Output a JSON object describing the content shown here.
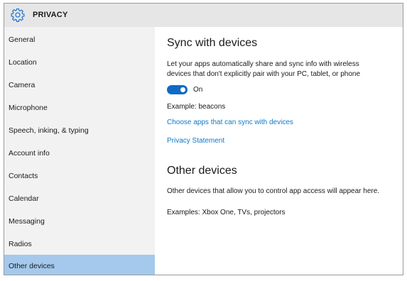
{
  "header": {
    "title": "PRIVACY",
    "icon": "gear-icon",
    "accent": "#2b7bd3"
  },
  "sidebar": {
    "items": [
      {
        "label": "General",
        "active": false
      },
      {
        "label": "Location",
        "active": false
      },
      {
        "label": "Camera",
        "active": false
      },
      {
        "label": "Microphone",
        "active": false
      },
      {
        "label": "Speech, inking, & typing",
        "active": false
      },
      {
        "label": "Account info",
        "active": false
      },
      {
        "label": "Contacts",
        "active": false
      },
      {
        "label": "Calendar",
        "active": false
      },
      {
        "label": "Messaging",
        "active": false
      },
      {
        "label": "Radios",
        "active": false
      },
      {
        "label": "Other devices",
        "active": true
      }
    ],
    "active_color": "#a4c9ec"
  },
  "main": {
    "sync": {
      "heading": "Sync with devices",
      "description_line1": "Let your apps automatically share and sync info with wireless",
      "description_line2": "devices that don't explicitly pair with your PC, tablet, or phone",
      "toggle_state": "On",
      "toggle_on": true,
      "example": "Example: beacons",
      "choose_link": "Choose apps that can sync with devices",
      "privacy_link": "Privacy Statement"
    },
    "other": {
      "heading": "Other devices",
      "description": "Other devices that allow you to control app access will appear here.",
      "examples": "Examples: Xbox One, TVs, projectors"
    }
  },
  "colors": {
    "link": "#0f78c8",
    "toggle": "#0f6bc4"
  }
}
